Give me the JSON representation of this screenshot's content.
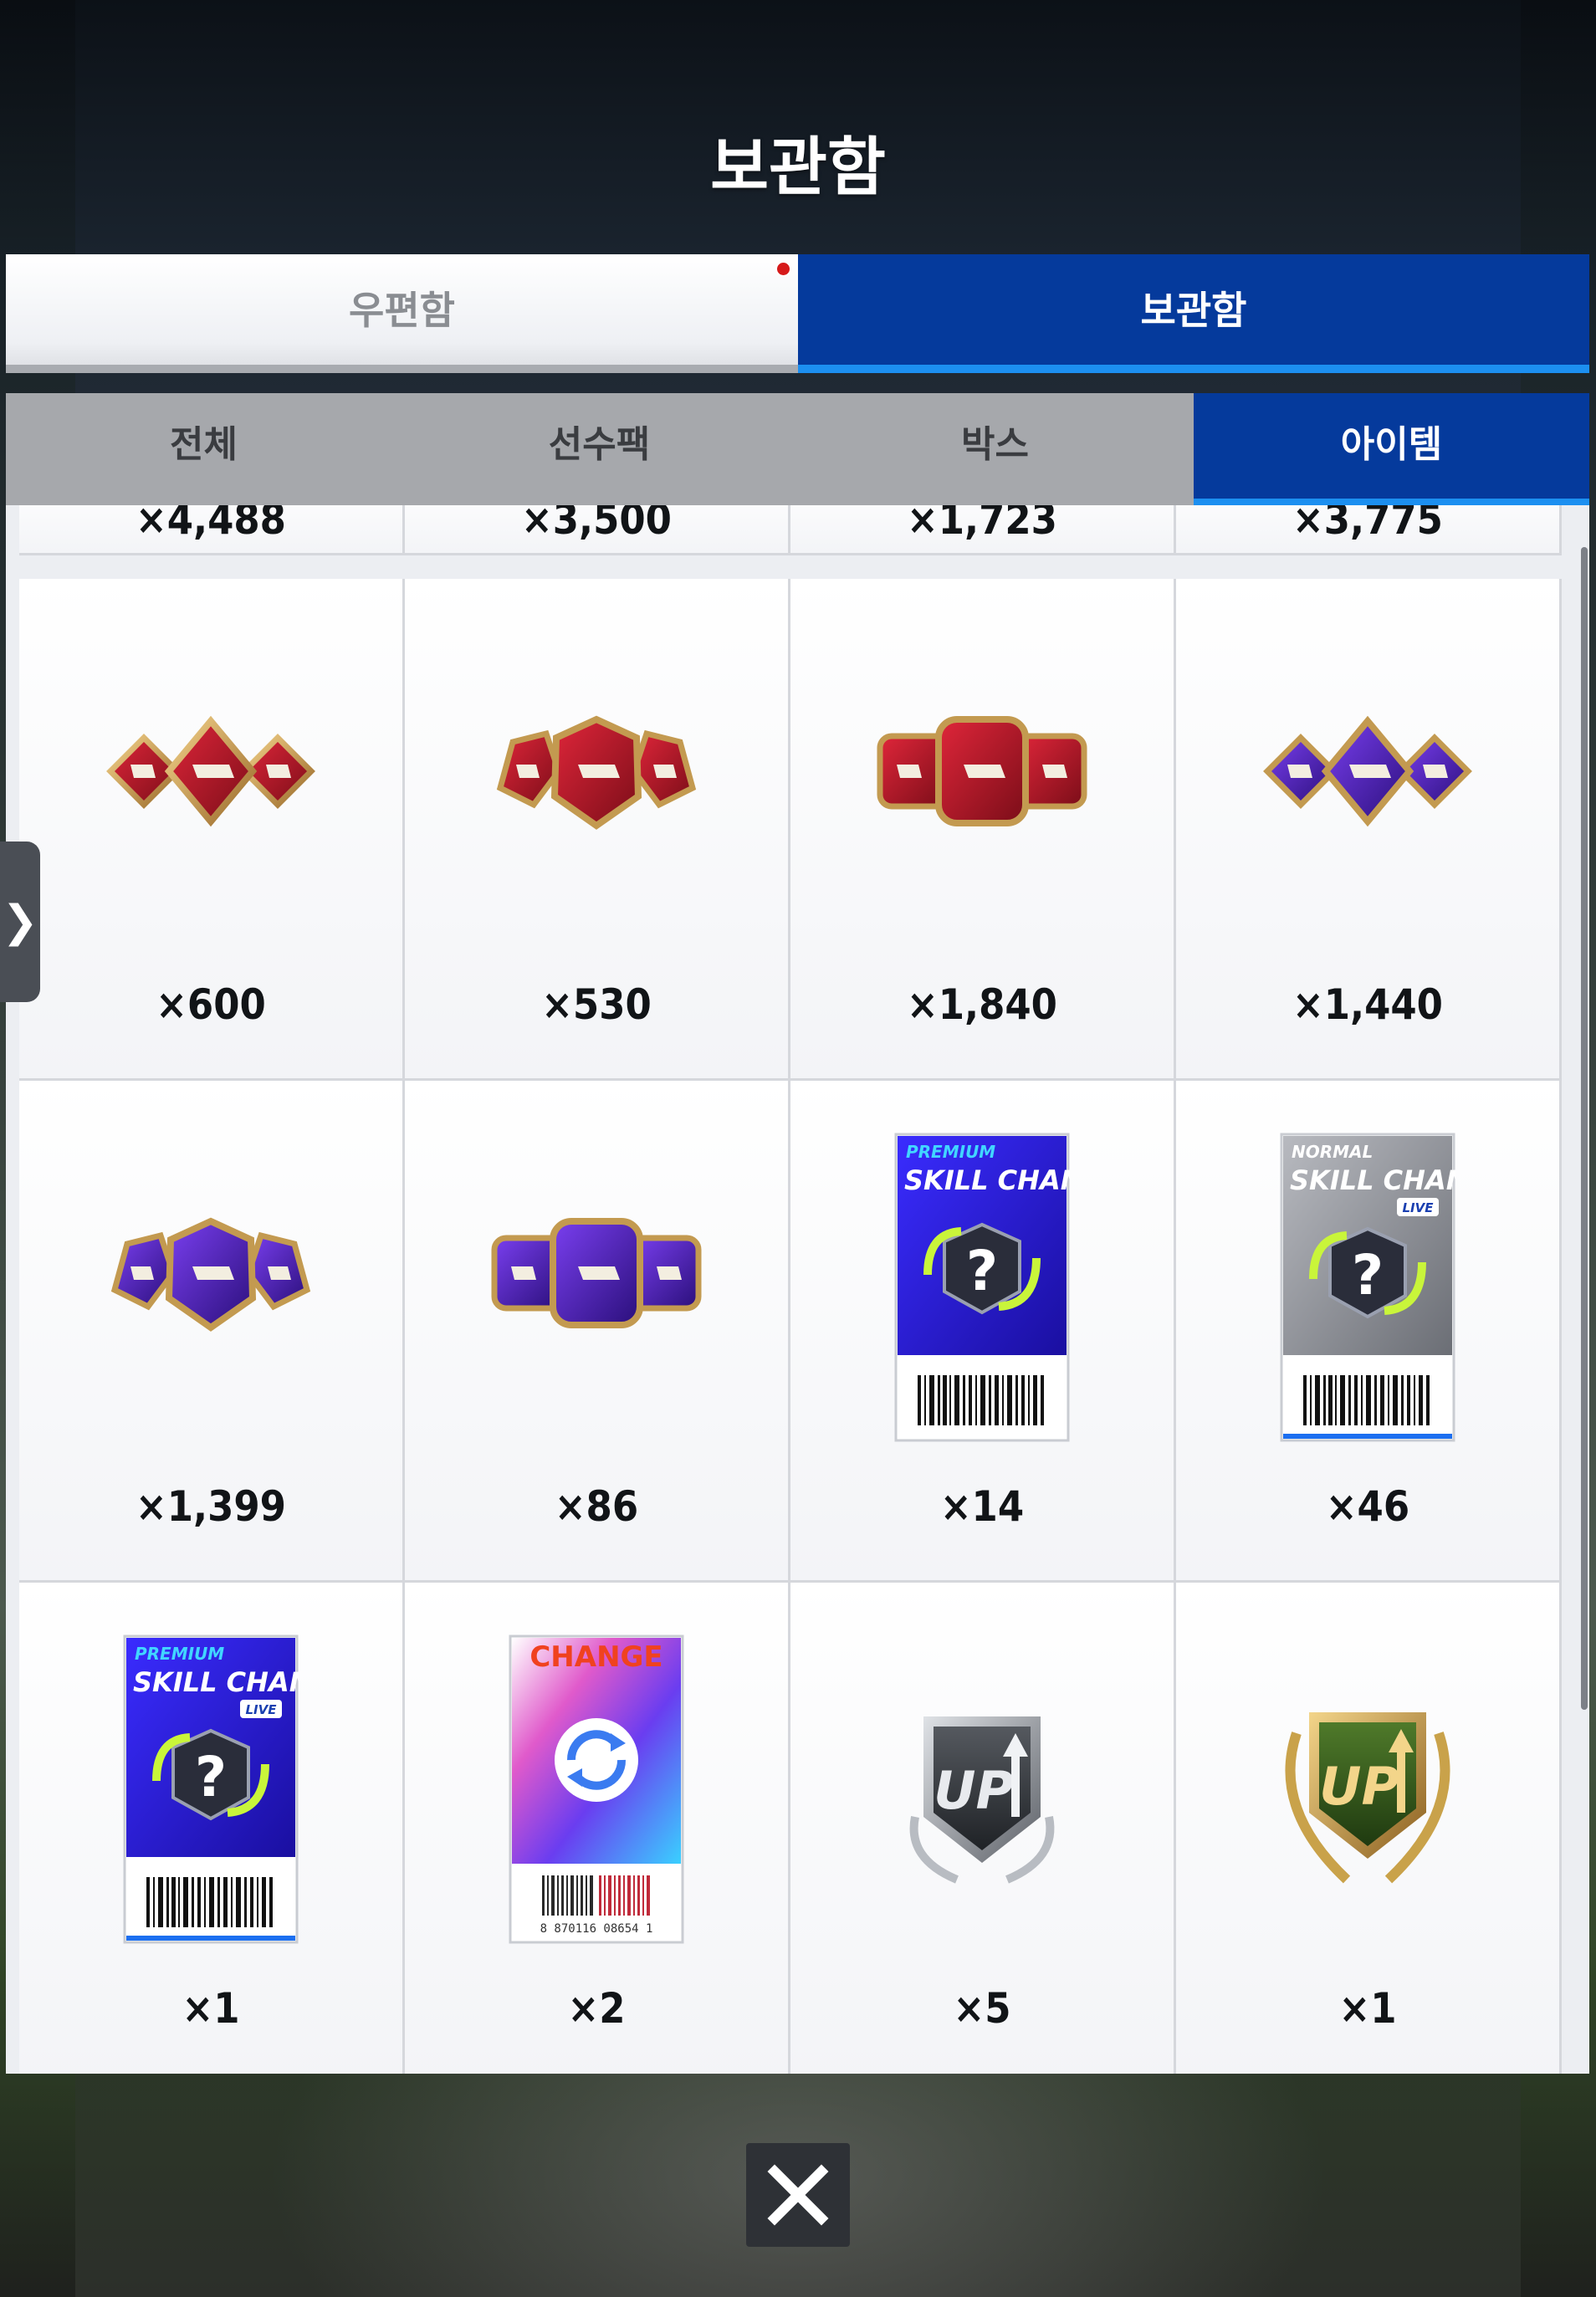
{
  "header": {
    "title": "보관함"
  },
  "main_tabs": [
    {
      "label": "우편함",
      "active": false,
      "has_notification": true
    },
    {
      "label": "보관함",
      "active": true
    }
  ],
  "category_tabs": [
    {
      "label": "전체",
      "active": false
    },
    {
      "label": "선수팩",
      "active": false
    },
    {
      "label": "박스",
      "active": false
    },
    {
      "label": "아이템",
      "active": true
    }
  ],
  "grid": {
    "partial_row": [
      "×4,488",
      "×3,500",
      "×1,723",
      "×3,775"
    ],
    "rows": [
      [
        {
          "icon": "red-gem-trio-icon",
          "count": "×600"
        },
        {
          "icon": "red-gem-trio-icon",
          "count": "×530"
        },
        {
          "icon": "red-gem-trio-square-icon",
          "count": "×1,840"
        },
        {
          "icon": "purple-gem-trio-icon",
          "count": "×1,440"
        }
      ],
      [
        {
          "icon": "purple-gem-trio-icon",
          "count": "×1,399"
        },
        {
          "icon": "purple-gem-trio-square-icon",
          "count": "×86"
        },
        {
          "icon": "premium-skill-change-ticket-icon",
          "count": "×14",
          "ticket_tier": "PREMIUM",
          "ticket_title": "SKILL CHANGE"
        },
        {
          "icon": "normal-skill-change-ticket-icon",
          "count": "×46",
          "ticket_tier": "NORMAL",
          "ticket_title": "SKILL CHANGE",
          "ticket_badge": "LIVE"
        }
      ],
      [
        {
          "icon": "premium-skill-change-live-ticket-icon",
          "count": "×1",
          "ticket_tier": "PREMIUM",
          "ticket_title": "SKILL CHANGE",
          "ticket_badge": "LIVE"
        },
        {
          "icon": "change-card-icon",
          "count": "×2",
          "card_title": "CHANGE",
          "barcode_text": "8 870116 08654 1"
        },
        {
          "icon": "silver-up-badge-icon",
          "count": "×5",
          "badge_text": "UP"
        },
        {
          "icon": "gold-up-badge-icon",
          "count": "×1",
          "badge_text": "UP"
        }
      ]
    ]
  },
  "colors": {
    "accent_blue": "#053a9c",
    "tab_underline": "#1c8ff0",
    "notification": "#d61a1a"
  },
  "controls": {
    "side_toggle_glyph": "❯",
    "close_icon": "close-icon"
  }
}
